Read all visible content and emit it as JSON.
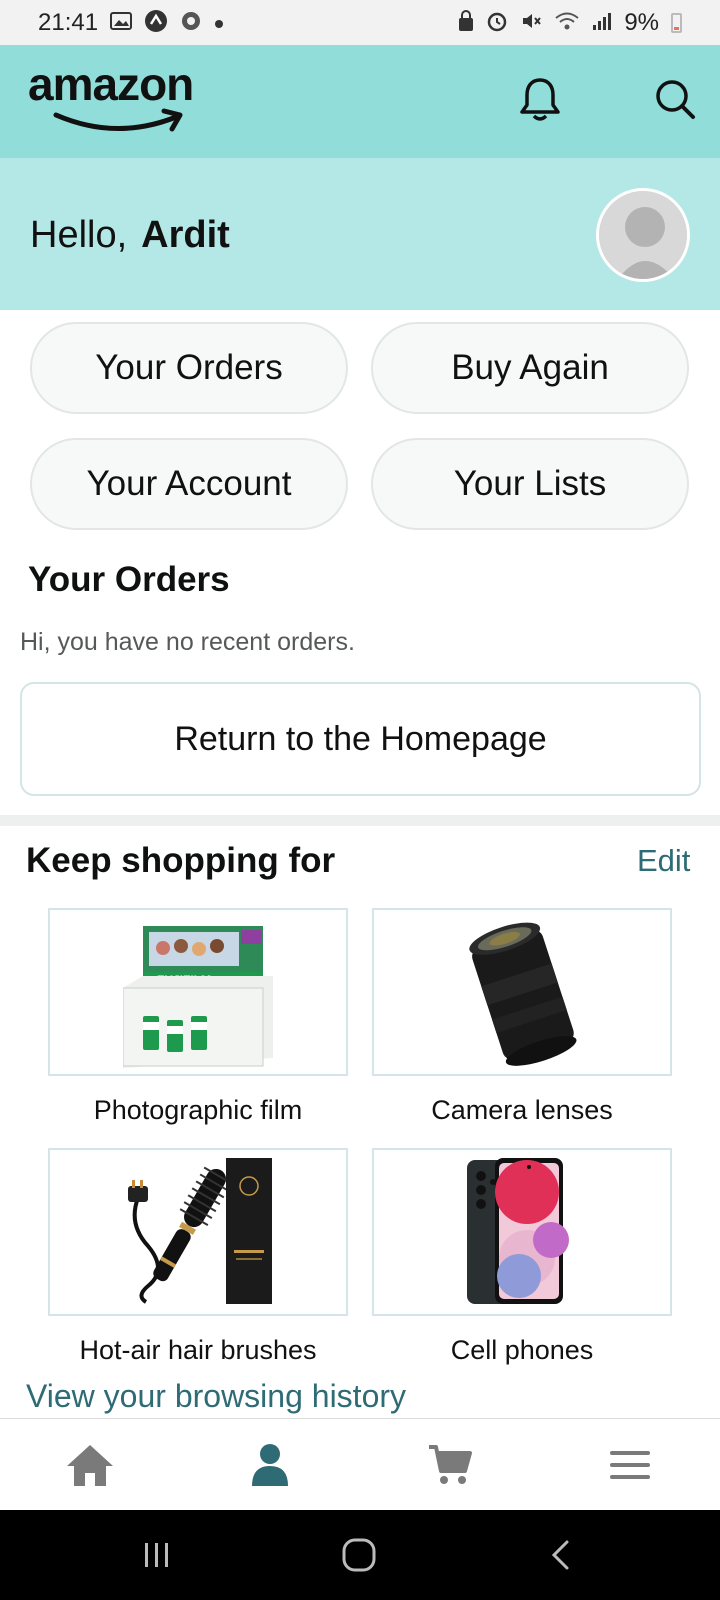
{
  "status_bar": {
    "time": "21:41",
    "battery": "9%",
    "icons_left": [
      "gallery-icon",
      "messenger-icon",
      "settings-icon",
      "dot-icon"
    ],
    "icons_right": [
      "lock-icon",
      "alarm-icon",
      "mute-icon",
      "wifi-icon",
      "signal-icon",
      "battery-icon"
    ]
  },
  "header": {
    "logo": "amazon",
    "notification_icon": "bell-icon",
    "search_icon": "search-icon",
    "accent": "#91ddd9"
  },
  "greeting": {
    "prefix": "Hello,",
    "name": "Ardit",
    "background": "#b4e8e6"
  },
  "quick_actions": {
    "your_orders": "Your Orders",
    "buy_again": "Buy Again",
    "your_account": "Your Account",
    "your_lists": "Your Lists"
  },
  "orders": {
    "title": "Your Orders",
    "empty_message": "Hi, you have no recent orders.",
    "return_button": "Return to the Homepage"
  },
  "keep_shopping": {
    "title": "Keep shopping for",
    "edit": "Edit",
    "items": [
      {
        "label": "Photographic film",
        "image": "film-box-image"
      },
      {
        "label": "Camera lenses",
        "image": "camera-lens-image"
      },
      {
        "label": "Hot-air hair brushes",
        "image": "hair-brush-image"
      },
      {
        "label": "Cell phones",
        "image": "cell-phone-image"
      }
    ],
    "history_link": "View your browsing history",
    "link_color": "#2e6b75"
  },
  "bottom_nav": {
    "items": [
      "home-icon",
      "account-icon",
      "cart-icon",
      "menu-icon"
    ],
    "active": "account-icon"
  },
  "system_nav": {
    "items": [
      "recent-apps-icon",
      "home-button-icon",
      "back-icon"
    ]
  }
}
